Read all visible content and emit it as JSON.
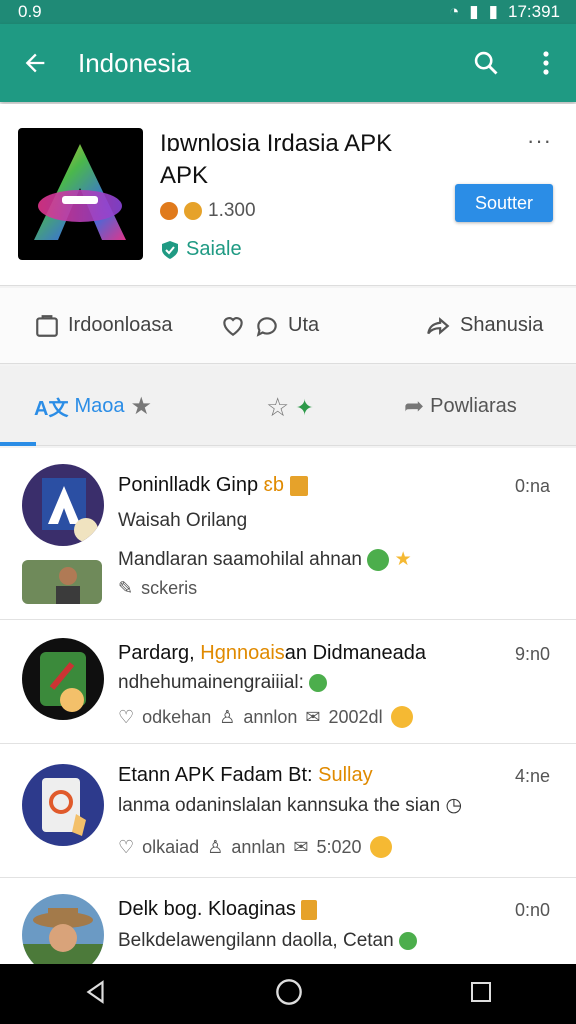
{
  "status": {
    "time": "0.9",
    "clock": "17:391"
  },
  "appbar": {
    "title": "Indonesia"
  },
  "app": {
    "title_line1": "Iɒwnlosia Irdasia APK",
    "title_line2": "APK",
    "rating": "1.300",
    "safe": "Saiale",
    "primary_button": "Soutter",
    "more": "···"
  },
  "actions": [
    {
      "label": "Irdoonloasa"
    },
    {
      "label": "Uta"
    },
    {
      "label": "Shanusia"
    }
  ],
  "tabs": [
    {
      "label": "Maoa"
    },
    {
      "label": ""
    },
    {
      "label": "Powliaras"
    }
  ],
  "posts": [
    {
      "title": "Poninlladk Ginp",
      "title_extra": "ɛb",
      "time": "0:na",
      "subtitle": "Waisah Orilang",
      "body": "Mandlaran saamohilal ahnan",
      "meta": "sckeris"
    },
    {
      "title": "Pardarg,",
      "title_hl": "Hgnnoais",
      "title_rest": "an Didmaneada",
      "time": "9:n0",
      "subtitle": "ndhehumainengraiiial:",
      "meta1": "odkehan",
      "meta2": "annlon",
      "meta3": "2002dl"
    },
    {
      "title": "Etann  APK Fadam Bt:",
      "title_hl": "Sullay",
      "time": "4:ne",
      "subtitle": "lanma odaninslalan kannsuka the sian",
      "meta1": "olkaiad",
      "meta2": "annlan",
      "meta3": "5:020"
    },
    {
      "title": "Delk bog. Kloaginas",
      "time": "0:n0",
      "subtitle": "Belkdelawengilann daolla, Cetan"
    }
  ],
  "colors": {
    "primary": "#1f9a83",
    "accent": "#2b8de6"
  }
}
